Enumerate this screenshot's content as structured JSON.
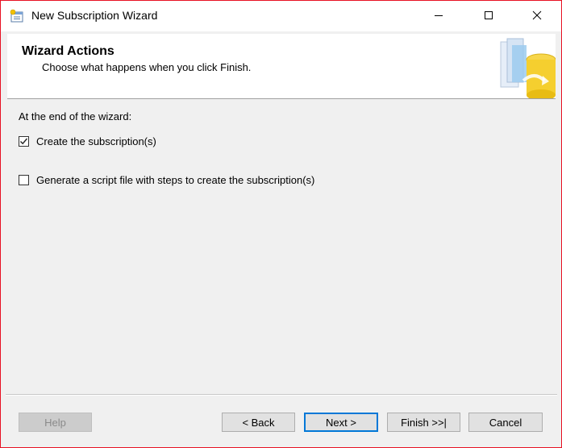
{
  "window": {
    "title": "New Subscription Wizard",
    "icon": "wizard-app-icon",
    "border_color": "#e81123"
  },
  "caption_buttons": {
    "minimize": "minimize-icon",
    "maximize": "maximize-icon",
    "close": "close-icon"
  },
  "header": {
    "title": "Wizard Actions",
    "subtitle": "Choose what happens when you click Finish.",
    "graphic": "database-wizard-graphic"
  },
  "main": {
    "section_label": "At the end of the wizard:",
    "options": [
      {
        "label": "Create the subscription(s)",
        "checked": true
      },
      {
        "label": "Generate a script file with steps to create the subscription(s)",
        "checked": false
      }
    ]
  },
  "footer": {
    "help": "Help",
    "back": "< Back",
    "next": "Next >",
    "finish": "Finish >>|",
    "cancel": "Cancel",
    "help_enabled": false,
    "default_button": "next",
    "accent_color": "#0078d7"
  }
}
